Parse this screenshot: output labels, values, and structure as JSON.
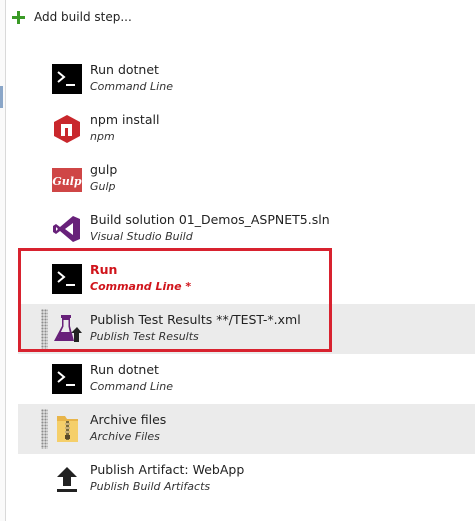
{
  "toolbar": {
    "add_label": "Add build step..."
  },
  "steps": [
    {
      "title": "Run dotnet",
      "subtitle": "Command Line",
      "icon": "command-line-icon"
    },
    {
      "title": "npm install",
      "subtitle": "npm",
      "icon": "npm-icon"
    },
    {
      "title": "gulp",
      "subtitle": "Gulp",
      "icon": "gulp-icon",
      "icon_text": "Gulp"
    },
    {
      "title": "Build solution 01_Demos_ASPNET5.sln",
      "subtitle": "Visual Studio Build",
      "icon": "visual-studio-icon"
    },
    {
      "title": "Run",
      "subtitle": "Command Line *",
      "icon": "command-line-icon",
      "selected": true
    },
    {
      "title": "Publish Test Results **/TEST-*.xml",
      "subtitle": "Publish Test Results",
      "icon": "publish-test-results-icon"
    },
    {
      "title": "Run dotnet",
      "subtitle": "Command Line",
      "icon": "command-line-icon"
    },
    {
      "title": "Archive files",
      "subtitle": "Archive Files",
      "icon": "archive-files-icon"
    },
    {
      "title": "Publish Artifact: WebApp",
      "subtitle": "Publish Build Artifacts",
      "icon": "publish-artifact-icon"
    }
  ],
  "colors": {
    "accent_add": "#3a9a26",
    "selected_text": "#d0141b",
    "highlight_border": "#d8222f",
    "hover_row": "#ebebeb",
    "npm_red": "#c9272c",
    "gulp_red": "#cf4646",
    "vs_purple": "#68217a"
  }
}
